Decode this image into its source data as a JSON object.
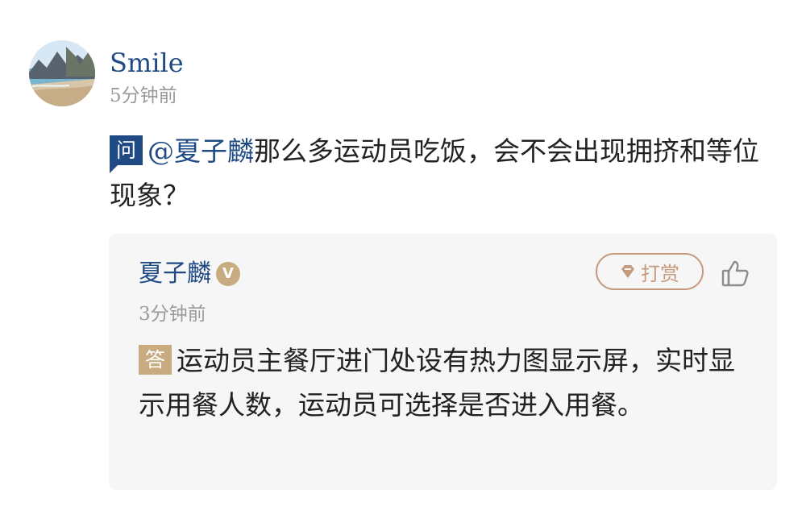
{
  "question": {
    "user_name": "Smile",
    "time": "5分钟前",
    "badge": "问",
    "mention": "@夏子麟",
    "text": "那么多运动员吃饭，会不会出现拥挤和等位现象？"
  },
  "answer": {
    "user_name": "夏子麟",
    "verified_mark": "V",
    "tip_label": "打赏",
    "time": "3分钟前",
    "badge": "答",
    "text": "运动员主餐厅进门处设有热力图显示屏，实时显示用餐人数，运动员可选择是否进入用餐。"
  },
  "icons": {
    "avatar": "avatar-landscape",
    "verified": "verified-badge-icon",
    "tip": "diamond-tip-icon",
    "like": "thumbs-up-icon"
  },
  "colors": {
    "brand_blue": "#1f4a83",
    "answer_gold": "#c8ab80",
    "tip_copper": "#c69a7f",
    "card_bg": "#f6f6f6",
    "muted_gray": "#9a9a9a"
  }
}
